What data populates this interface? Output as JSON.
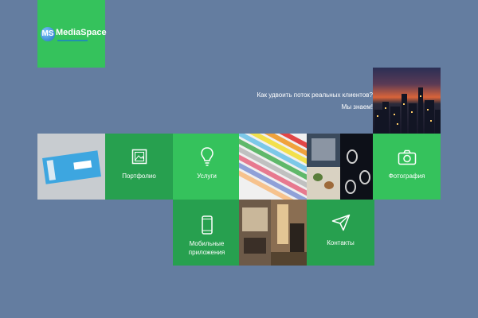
{
  "brand": {
    "name": "MediaSpace",
    "mark": "MS"
  },
  "slogan": {
    "line1": "Как удвоить поток реальных клиентов?",
    "line2": "Мы знаем!"
  },
  "tiles": {
    "portfolio": {
      "label": "Портфолио",
      "icon": "image-icon"
    },
    "services": {
      "label": "Услуги",
      "icon": "lightbulb-icon"
    },
    "photography": {
      "label": "Фотография",
      "icon": "camera-icon"
    },
    "mobile": {
      "label_line1": "Мобильные",
      "label_line2": "приложения",
      "icon": "smartphone-icon"
    },
    "contacts": {
      "label": "Контакты",
      "icon": "paper-plane-icon"
    }
  },
  "colors": {
    "background": "#647da0",
    "accent": "#35c25c",
    "accent_dark": "#27a04f"
  }
}
